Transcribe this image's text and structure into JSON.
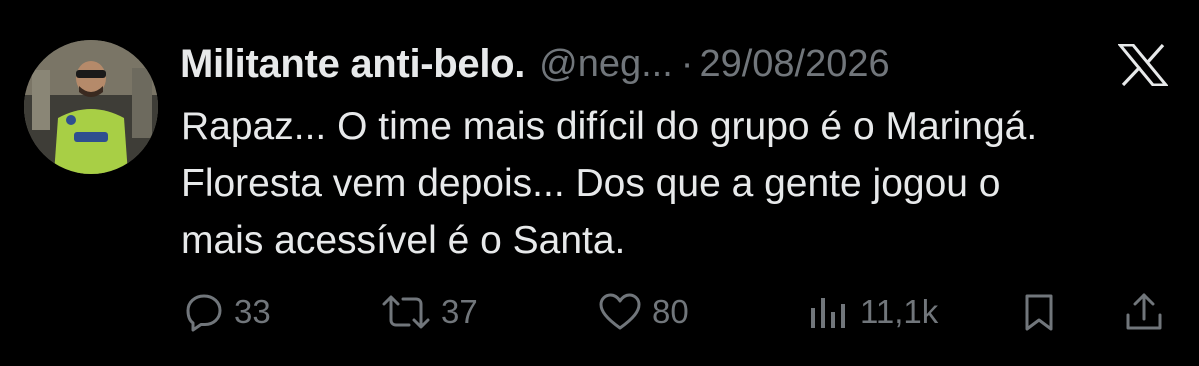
{
  "tweet": {
    "display_name": "Militante anti-belo.",
    "handle": "@neg...",
    "separator": "·",
    "date": "29/08/2026",
    "text": "Rapaz... O time mais difícil do grupo é o Maringá.\nFloresta vem depois... Dos que a gente jogou o\nmais acessível é o Santa.",
    "avatar": "avatar-photo",
    "platform_icon": "x-logo-icon"
  },
  "actions": {
    "replies": "33",
    "retweets": "37",
    "likes": "80",
    "views": "11,1k"
  },
  "icons": {
    "reply": "reply-icon",
    "retweet": "retweet-icon",
    "like": "heart-icon",
    "views": "views-icon",
    "bookmark": "bookmark-icon",
    "share": "share-icon"
  },
  "colors": {
    "background": "#000000",
    "primary_text": "#e7e9ea",
    "secondary_text": "#71767b"
  }
}
